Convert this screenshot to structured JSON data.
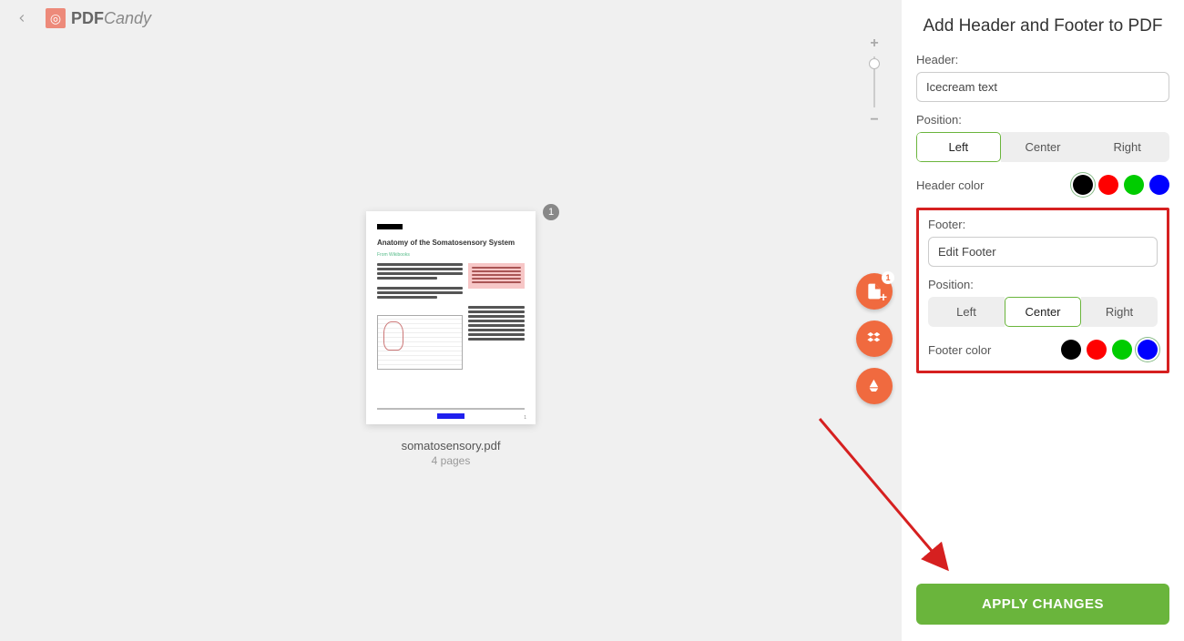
{
  "brand": {
    "bold": "PDF",
    "script": "Candy"
  },
  "sidebar": {
    "title": "Add Header and Footer to PDF",
    "header": {
      "label": "Header:",
      "value": "Icecream text",
      "position_label": "Position:",
      "positions": [
        "Left",
        "Center",
        "Right"
      ],
      "position_active": 0,
      "color_label": "Header color",
      "colors": [
        "#000000",
        "#ff0000",
        "#00cc00",
        "#0000ff"
      ],
      "color_active": 0
    },
    "footer": {
      "label": "Footer:",
      "value": "Edit Footer",
      "position_label": "Position:",
      "positions": [
        "Left",
        "Center",
        "Right"
      ],
      "position_active": 1,
      "color_label": "Footer color",
      "colors": [
        "#000000",
        "#ff0000",
        "#00cc00",
        "#0000ff"
      ],
      "color_active": 3
    },
    "apply_label": "APPLY CHANGES"
  },
  "preview": {
    "badge": "1",
    "doc_title": "Anatomy of the Somatosensory System",
    "filename": "somatosensory.pdf",
    "pages_text": "4 pages"
  },
  "fab": {
    "add_badge": "1"
  }
}
